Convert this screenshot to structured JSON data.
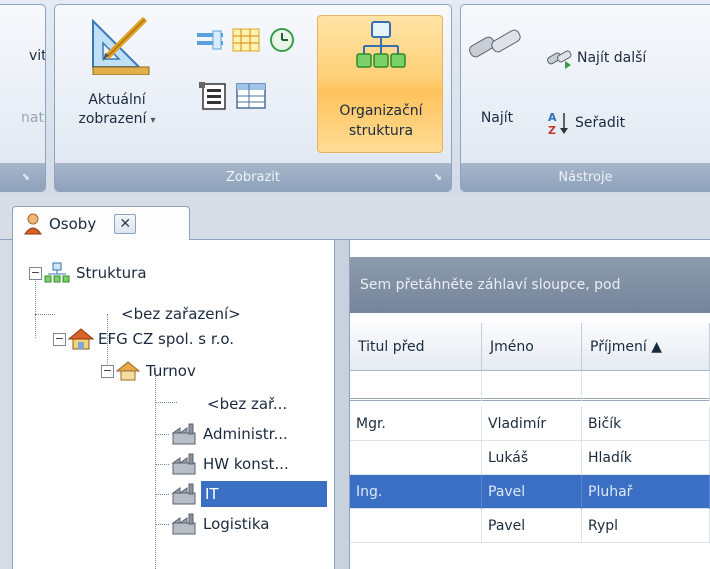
{
  "ribbon": {
    "left_group": {
      "top_fragment": "vit",
      "bottom_fragment": "nat"
    },
    "zobrazit": {
      "title": "Zobrazit",
      "current_view_line1": "Aktuální",
      "current_view_line2": "zobrazení",
      "org_line1": "Organizační",
      "org_line2": "struktura"
    },
    "nastroje": {
      "title": "Nástroje",
      "find": "Najít",
      "find_next": "Najít další",
      "sort": "Seřadit"
    }
  },
  "tabs": [
    {
      "label": "Osoby"
    }
  ],
  "tree": {
    "root": "Struktura",
    "unassigned": "<bez zařazení>",
    "company": "EFG CZ spol. s r.o.",
    "branch": "Turnov",
    "branch_unassigned": "<bez zař...",
    "departments": [
      "Administr...",
      "HW konst...",
      "IT",
      "Logistika"
    ],
    "selected_department": "IT"
  },
  "grid": {
    "group_panel_text": "Sem přetáhněte záhlaví sloupce, pod",
    "columns": [
      "Titul před",
      "Jméno",
      "Příjmení ▲"
    ],
    "rows": [
      {
        "title": "Mgr.",
        "first": "Vladimír",
        "last": "Bičík"
      },
      {
        "title": "",
        "first": "Lukáš",
        "last": "Hladík"
      },
      {
        "title": "Ing.",
        "first": "Pavel",
        "last": "Pluhař"
      },
      {
        "title": "",
        "first": "Pavel",
        "last": "Rypl"
      }
    ],
    "selected_row": 2
  },
  "colors": {
    "selection": "#3a6fc4",
    "ribbon_footer": "#9aabc2",
    "active_button": "#ffd078"
  }
}
